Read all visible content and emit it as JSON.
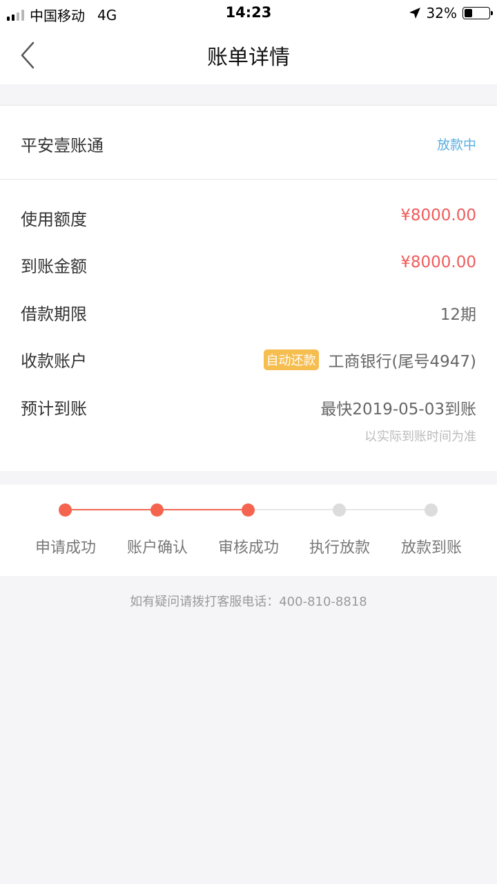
{
  "status_bar": {
    "carrier": "中国移动",
    "network": "4G",
    "time": "14:23",
    "battery": "32%",
    "battery_level": 0.32,
    "signal_bars_active": 2,
    "signal_bars_total": 4
  },
  "nav": {
    "title": "账单详情",
    "back_icon": "chevron-left-icon"
  },
  "product": {
    "name": "平安壹账通",
    "status": "放款中",
    "status_color": "#5aaee0"
  },
  "details": {
    "used_limit": {
      "label": "使用额度",
      "value": "¥8000.00"
    },
    "received_amount": {
      "label": "到账金额",
      "value": "¥8000.00"
    },
    "loan_term": {
      "label": "借款期限",
      "value": "12期"
    },
    "receiving_account": {
      "label": "收款账户",
      "tag": "自动还款",
      "value": "工商银行(尾号4947)"
    },
    "expected_arrival": {
      "label": "预计到账",
      "value": "最快2019-05-03到账",
      "note": "以实际到账时间为准"
    }
  },
  "progress": {
    "steps": [
      {
        "label": "申请成功",
        "done": true
      },
      {
        "label": "账户确认",
        "done": true
      },
      {
        "label": "审核成功",
        "done": true
      },
      {
        "label": "执行放款",
        "done": false
      },
      {
        "label": "放款到账",
        "done": false
      }
    ],
    "active_color": "#f4644e",
    "inactive_color": "#dcdcdc"
  },
  "footer": {
    "note": "如有疑问请拨打客服电话：400-810-8818"
  },
  "colors": {
    "amount_red": "#ef5b5b",
    "tag_yellow": "#f6bd4f"
  }
}
